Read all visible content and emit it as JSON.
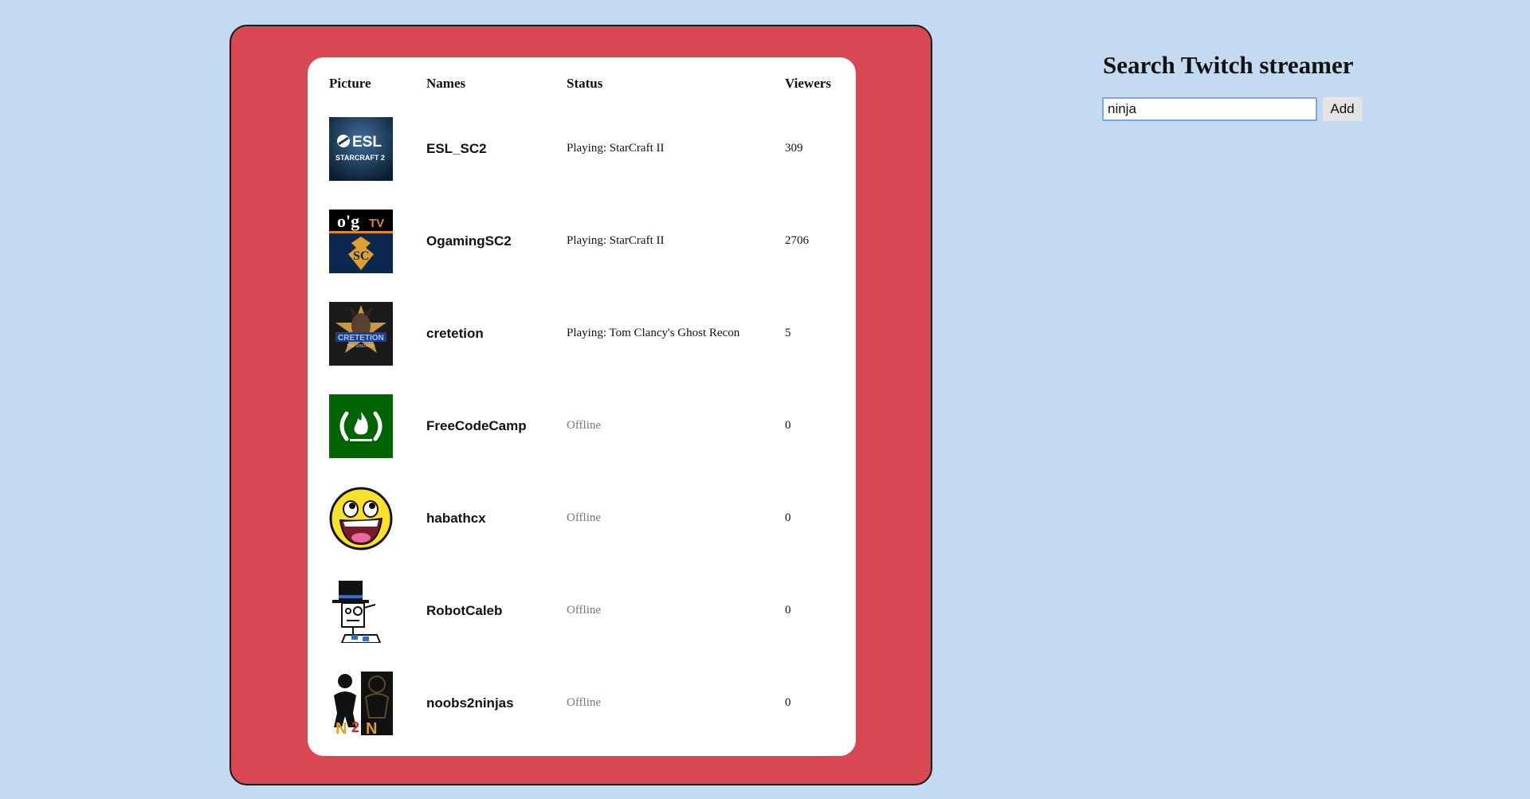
{
  "table": {
    "headers": {
      "picture": "Picture",
      "names": "Names",
      "status": "Status",
      "viewers": "Viewers"
    },
    "rows": [
      {
        "name": "ESL_SC2",
        "status": "Playing: StarCraft II",
        "viewers": "309",
        "online": true,
        "avatar_icon": "esl-starcraft2-logo"
      },
      {
        "name": "OgamingSC2",
        "status": "Playing: StarCraft II",
        "viewers": "2706",
        "online": true,
        "avatar_icon": "ogtv-sc-logo"
      },
      {
        "name": "cretetion",
        "status": "Playing: Tom Clancy's Ghost Recon",
        "viewers": "5",
        "online": true,
        "avatar_icon": "dog-sheriff-badge-logo"
      },
      {
        "name": "FreeCodeCamp",
        "status": "Offline",
        "viewers": "0",
        "online": false,
        "avatar_icon": "freecodecamp-flame-logo"
      },
      {
        "name": "habathcx",
        "status": "Offline",
        "viewers": "0",
        "online": false,
        "avatar_icon": "awesome-smiley-face"
      },
      {
        "name": "RobotCaleb",
        "status": "Offline",
        "viewers": "0",
        "online": false,
        "avatar_icon": "top-hat-robot-cartoon"
      },
      {
        "name": "noobs2ninjas",
        "status": "Offline",
        "viewers": "0",
        "online": false,
        "avatar_icon": "n2n-baby-ninja-logo"
      }
    ]
  },
  "search": {
    "title": "Search Twitch streamer",
    "input_value": "ninja",
    "add_label": "Add"
  },
  "colors": {
    "background": "#c4daf1",
    "panel": "#d94852",
    "card": "#ffffff",
    "offline_text": "#777777"
  }
}
